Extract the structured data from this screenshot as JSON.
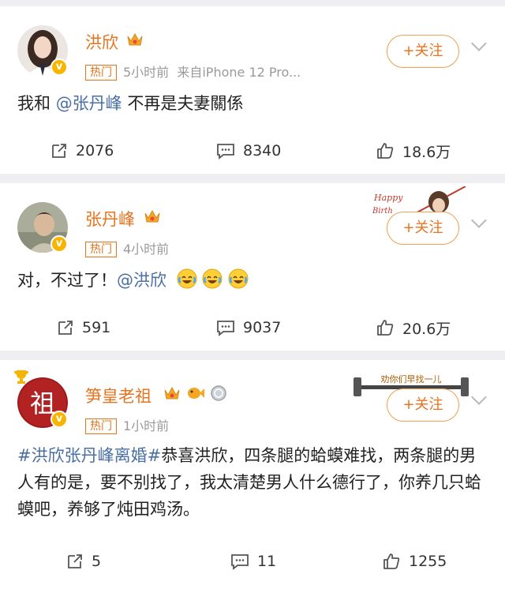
{
  "posts": [
    {
      "author": "洪欣",
      "meta_tag": "热门",
      "meta_time": "5小时前",
      "meta_source": "来自iPhone 12 Pro...",
      "follow_label": "+关注",
      "content_prefix": "我和 ",
      "content_mention": "@张丹峰",
      "content_suffix": " 不再是夫妻關係",
      "repost_count": "2076",
      "comment_count": "8340",
      "like_count": "18.6万"
    },
    {
      "author": "张丹峰",
      "meta_tag": "热门",
      "meta_time": "4小时前",
      "follow_label": "+关注",
      "decor_text": "Happy Birth",
      "content_prefix": "对，不过了！",
      "content_mention": "@洪欣",
      "repost_count": "591",
      "comment_count": "9037",
      "like_count": "20.6万"
    },
    {
      "author": "笋皇老祖",
      "avatar_char": "祖",
      "meta_tag": "热门",
      "meta_time": "1小时前",
      "follow_label": "+关注",
      "decor_text": "劝你们早找一儿",
      "content_hashtag": "#洪欣张丹峰离婚#",
      "content_text": "恭喜洪欣，四条腿的蛤蟆难找，两条腿的男人有的是，要不别找了，我太清楚男人什么德行了，你养几只蛤蟆吧，养够了炖田鸡汤。",
      "repost_count": "5",
      "comment_count": "11",
      "like_count": "1255"
    }
  ],
  "colors": {
    "author": "#e8731e",
    "link": "#4a6fa5",
    "verified": "#f7b500",
    "background": "#efeff2"
  }
}
